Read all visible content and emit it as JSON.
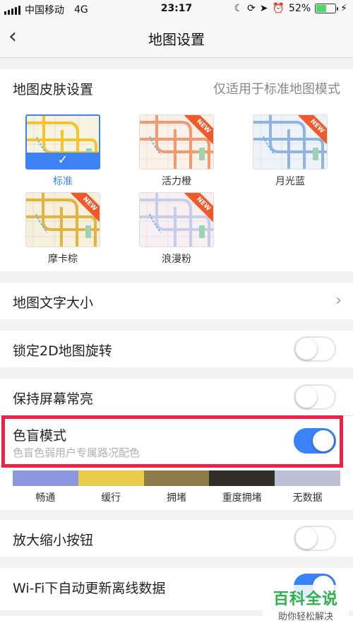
{
  "status_bar": {
    "carrier": "中国移动",
    "network": "4G",
    "time": "23:17",
    "battery_percent": "52%",
    "battery_level": 0.52,
    "icons": [
      "moon-icon",
      "lock-rotation-icon",
      "location-arrow-icon",
      "alarm-icon",
      "charging-icon"
    ]
  },
  "nav": {
    "back_icon": "chevron-left-icon",
    "title": "地图设置"
  },
  "skin_section": {
    "title": "地图皮肤设置",
    "note": "仅适用于标准地图模式",
    "options": [
      {
        "label": "标准",
        "selected": true,
        "is_new": false,
        "color": "#f2c52e"
      },
      {
        "label": "活力橙",
        "selected": false,
        "is_new": true,
        "color": "#f19a6c"
      },
      {
        "label": "月光蓝",
        "selected": false,
        "is_new": true,
        "color": "#8fb4e3"
      },
      {
        "label": "摩卡棕",
        "selected": false,
        "is_new": true,
        "color": "#e3b340"
      },
      {
        "label": "浪漫粉",
        "selected": false,
        "is_new": true,
        "color": "#c5cde9"
      }
    ],
    "new_badge": "NEW"
  },
  "text_size": {
    "label": "地图文字大小"
  },
  "settings": {
    "lock_rotation": {
      "label": "锁定2D地图旋转",
      "on": false
    },
    "keep_screen_on": {
      "label": "保持屏幕常亮",
      "on": false
    },
    "color_blind": {
      "label": "色盲模式",
      "sublabel": "色盲色弱用户专属路况配色",
      "on": true
    },
    "zoom_buttons": {
      "label": "放大缩小按钮",
      "on": false
    },
    "wifi_update": {
      "label": "Wi-Fi下自动更新离线数据",
      "on": true
    }
  },
  "traffic_legend": [
    {
      "label": "畅通",
      "color": "#8b98df"
    },
    {
      "label": "缓行",
      "color": "#e8cc4a"
    },
    {
      "label": "拥堵",
      "color": "#8e7b48"
    },
    {
      "label": "重度拥堵",
      "color": "#302e29"
    },
    {
      "label": "无数据",
      "color": "#bcbfd6"
    }
  ],
  "watermark": {
    "title": "百科全说",
    "subtitle": "助你轻松解决"
  },
  "colors": {
    "accent": "#3d82f5",
    "highlight": "#ee2244",
    "new_badge": "#f05a2a"
  }
}
